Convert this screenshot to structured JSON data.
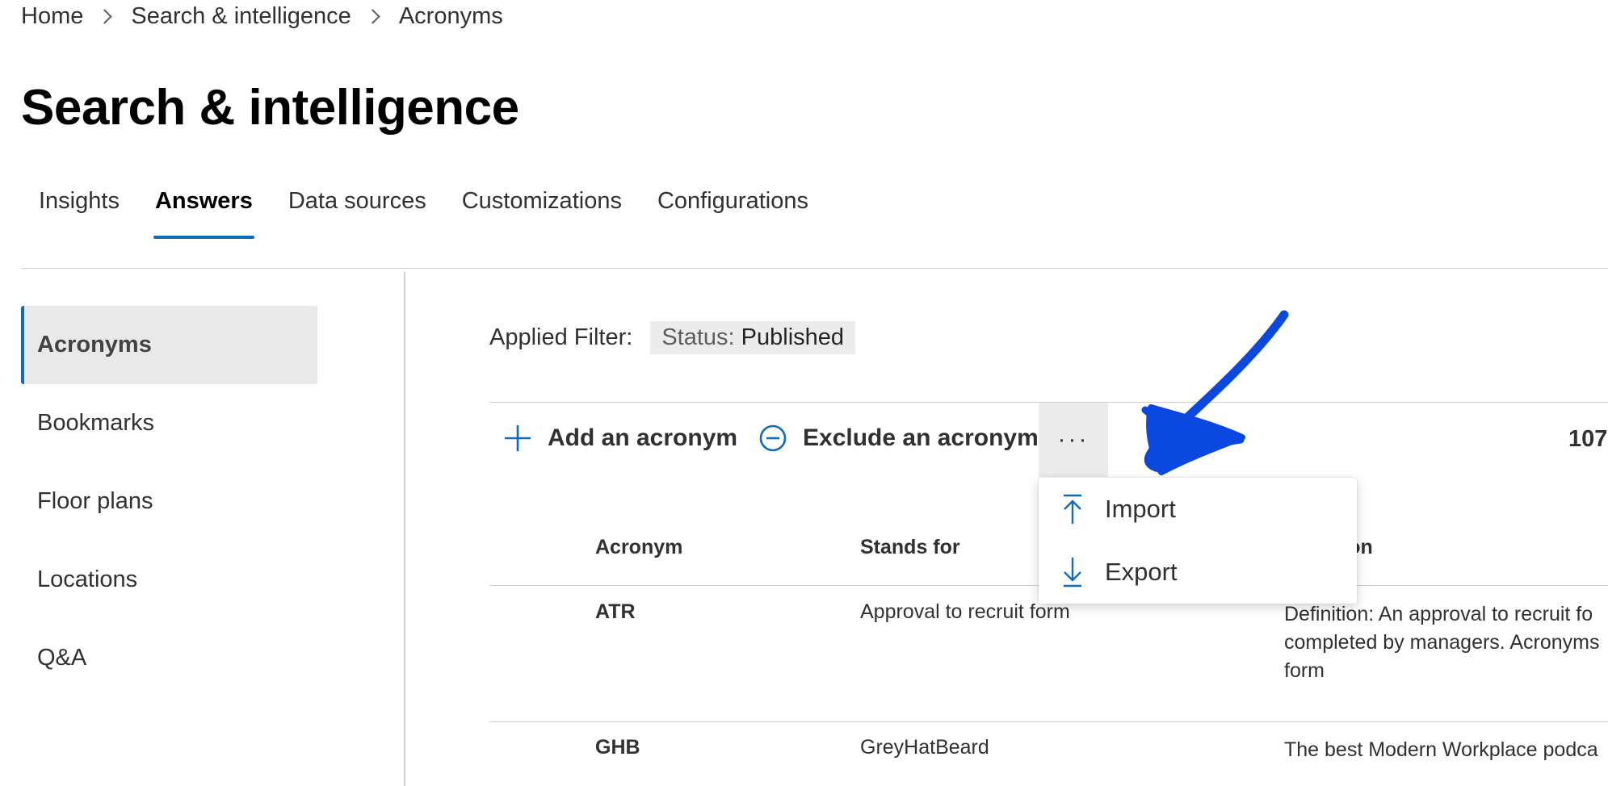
{
  "breadcrumb": {
    "items": [
      "Home",
      "Search & intelligence",
      "Acronyms"
    ]
  },
  "page": {
    "title": "Search & intelligence"
  },
  "tabs": [
    {
      "label": "Insights"
    },
    {
      "label": "Answers",
      "active": true
    },
    {
      "label": "Data sources"
    },
    {
      "label": "Customizations"
    },
    {
      "label": "Configurations"
    }
  ],
  "sidebar": {
    "items": [
      {
        "label": "Acronyms",
        "active": true
      },
      {
        "label": "Bookmarks"
      },
      {
        "label": "Floor plans"
      },
      {
        "label": "Locations"
      },
      {
        "label": "Q&A"
      }
    ]
  },
  "filter": {
    "label": "Applied Filter:",
    "chip_key": "Status:",
    "chip_value": "Published"
  },
  "toolbar": {
    "add_label": "Add an acronym",
    "exclude_label": "Exclude an acronym",
    "more_label": "···",
    "count": "107"
  },
  "menu": {
    "items": [
      {
        "label": "Import",
        "icon": "import-arrow-up-icon"
      },
      {
        "label": "Export",
        "icon": "export-arrow-down-icon"
      }
    ]
  },
  "table": {
    "columns": [
      "Acronym",
      "Stands for",
      "tion"
    ],
    "rows": [
      {
        "acronym": "ATR",
        "stands_for": "Approval to recruit form",
        "description_lines": [
          "Definition: An approval to recruit fo",
          "completed by managers. Acronyms",
          "form"
        ]
      },
      {
        "acronym": "GHB",
        "stands_for": "GreyHatBeard",
        "description_lines": [
          "The best Modern Workplace podca"
        ]
      }
    ]
  },
  "colors": {
    "accent": "#0f6cbd",
    "annotation": "#0a48e0",
    "selected_bg": "#e9e9e9"
  }
}
